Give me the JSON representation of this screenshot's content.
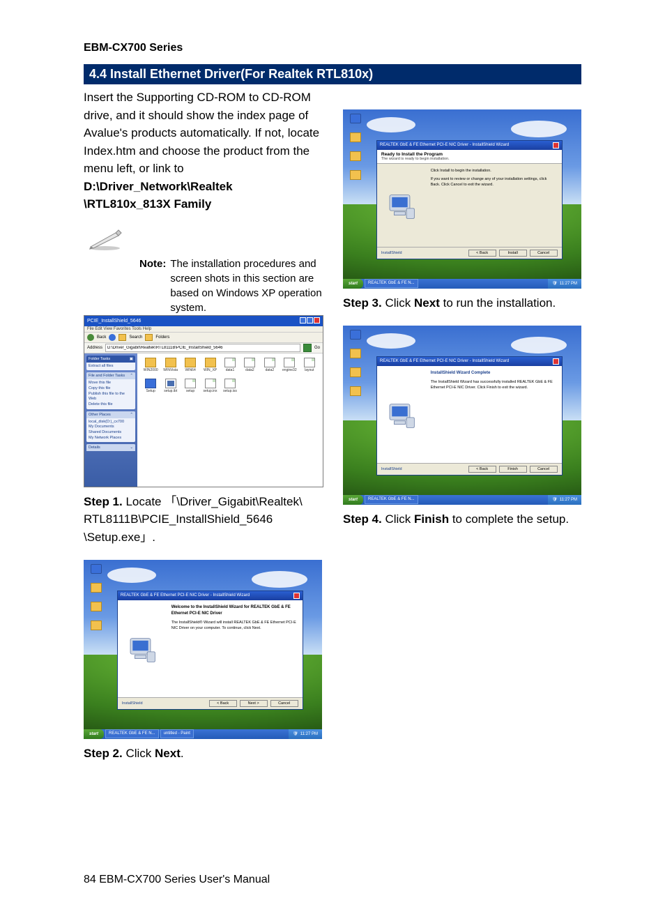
{
  "doc": {
    "series": "EBM-CX700 Series",
    "section_title": "4.4 Install Ethernet Driver(For Realtek RTL810x)",
    "intro_a": "Insert the Supporting CD-ROM to CD-ROM drive, and it should show the index page of Avalue's products automatically. If not, locate Index.htm and choose the product from the menu left, or link to ",
    "intro_bold": "D:\\Driver_Network\\Realtek \\RTL810x_813X Family",
    "note_label": "Note:",
    "note_text": "The installation procedures and screen shots in this section are based on Windows XP operation system.",
    "step1_lbl": "Step 1.",
    "step1_txt": " Locate  「\\Driver_Gigabit\\Realtek\\ RTL8111B\\PCIE_InstallShield_5646 \\Setup.exe」.",
    "step2_lbl": "Step 2.",
    "step2_txt_a": " Click ",
    "step2_bold": "Next",
    "step2_txt_b": ".",
    "step3_lbl": "Step 3.",
    "step3_txt_a": " Click ",
    "step3_bold": "Next",
    "step3_txt_b": " to run the installation.",
    "step4_lbl": "Step 4.",
    "step4_txt_a": " Click ",
    "step4_bold": "Finish",
    "step4_txt_b": " to complete the setup.",
    "footer": "84 EBM-CX700 Series User's Manual"
  },
  "explorer": {
    "title": "PCIE_InstallShield_5646",
    "menu": "File  Edit  View  Favorites  Tools  Help",
    "back": "Back",
    "search": "Search",
    "folders": "Folders",
    "address_lbl": "Address",
    "address": "D:\\Driver_Gigabit\\Realtek\\RTL8111B\\PCIE_InstallShield_5646",
    "go": "Go",
    "panel1_hdr": "Folder Tasks",
    "p1_a": "Extract all files",
    "panel2_hdr": "File and Folder Tasks",
    "p2_a": "Move this file",
    "p2_b": "Copy this file",
    "p2_c": "Publish this file to the Web",
    "p2_d": "Delete this file",
    "panel3_hdr": "Other Places",
    "p3_a": "local_disk(D:)_cx700",
    "p3_b": "My Documents",
    "p3_c": "Shared Documents",
    "p3_d": "My Network Places",
    "panel4_hdr": "Details",
    "items": [
      "WIN2000",
      "WINVista",
      "WIN64",
      "WIN_XP",
      "data1",
      "data2",
      "data2",
      "engine32",
      "layout",
      "Setup",
      "setup.ibt",
      "setup",
      "setup.inx",
      "setup.iss"
    ]
  },
  "wiz2": {
    "title": "REALTEK GbE & FE Ethernet PCI-E NIC Driver - InstallShield Wizard",
    "welcome": "Welcome to the InstallShield Wizard for REALTEK GbE & FE Ethernet PCI-E NIC Driver",
    "body": "The InstallShield® Wizard will install REALTEK GbE & FE Ethernet PCI-E NIC Driver on your computer. To continue, click Next.",
    "status": "InstallShield",
    "back": "< Back",
    "next": "Next >",
    "cancel": "Cancel",
    "task1": "REALTEK GbE & FE N...",
    "task2": "untitled - Paint",
    "time": "11:27 PM"
  },
  "wiz3": {
    "title": "REALTEK GbE & FE Ethernet PCI-E NIC Driver - InstallShield Wizard",
    "hdr1": "Ready to Install the Program",
    "hdr2": "The wizard is ready to begin installation.",
    "body1": "Click Install to begin the installation.",
    "body2": "If you want to review or change any of your installation settings, click Back. Click Cancel to exit the wizard.",
    "status": "InstallShield",
    "back": "< Back",
    "install": "Install",
    "cancel": "Cancel",
    "task1": "REALTEK GbE & FE N...",
    "time": "11:27 PM"
  },
  "wiz4": {
    "title": "REALTEK GbE & FE Ethernet PCI-E NIC Driver - InstallShield Wizard",
    "done_hl": "InstallShield Wizard Complete",
    "body": "The InstallShield Wizard has successfully installed REALTEK GbE & FE Ethernet PCI-E NIC Driver. Click Finish to exit the wizard.",
    "status": "InstallShield",
    "back": "< Back",
    "finish": "Finish",
    "cancel": "Cancel",
    "task1": "REALTEK GbE & FE N...",
    "time": "11:27 PM"
  },
  "start": "start"
}
